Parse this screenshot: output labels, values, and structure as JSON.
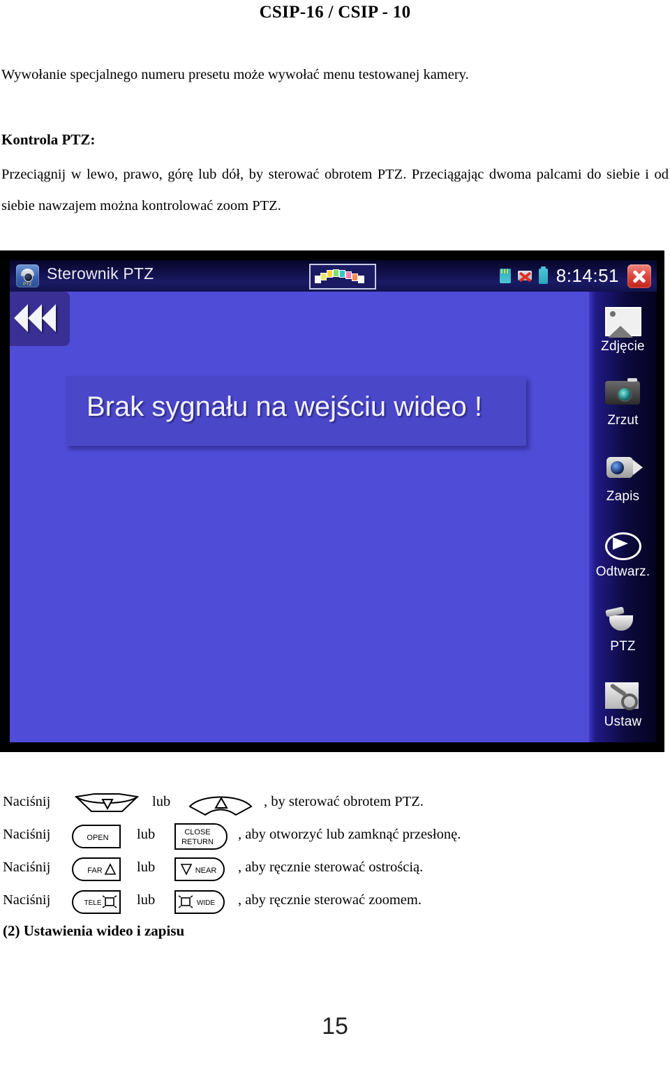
{
  "document": {
    "title": "CSIP-16 / CSIP - 10",
    "intro": "Wywołanie specjalnego numeru presetu może wywołać menu testowanej kamery.",
    "section_heading": "Kontrola PTZ:",
    "body": "Przeciągnij w lewo, prawo, górę lub dół, by sterować obrotem PTZ. Przeciągając dwoma palcami do siebie i od siebie nawzajem można kontrolować zoom PTZ.",
    "next_section": "(2) Ustawienia wideo i zapisu",
    "page_number": "15"
  },
  "screenshot": {
    "titlebar": {
      "app_icon": "ptz-camera-icon",
      "app_icon_tag": "PTZ",
      "title": "Sterownik PTZ",
      "signal_icon": "signal-waveform-icon",
      "sd_icon": "sd-card-icon",
      "network_icon": "network-disconnected-icon",
      "battery_icon": "battery-icon",
      "time": "8:14:51",
      "close_icon": "close-icon"
    },
    "back_button": "collapse-left-icon",
    "video_message": "Brak sygnału na wejściu wideo !",
    "colors": {
      "video_area": "#4f4cd8",
      "message_box": "#4b47c9",
      "titlebar": "#131350",
      "sidebar": "#0d0a3e",
      "close_button": "#e04b42",
      "frame": "#000000"
    },
    "sidebar": [
      {
        "icon": "picture-icon",
        "label": "Zdjęcie"
      },
      {
        "icon": "camera-icon",
        "label": "Zrzut"
      },
      {
        "icon": "camcorder-icon",
        "label": "Zapis"
      },
      {
        "icon": "play-icon",
        "label": "Odtwarz."
      },
      {
        "icon": "ptz-dome-icon",
        "label": "PTZ"
      },
      {
        "icon": "wrench-gear-icon",
        "label": "Ustaw"
      }
    ]
  },
  "instructions": [
    {
      "prefix": "Naciśnij",
      "button_a": {
        "shape": "arc-down-button",
        "glyph": "▽",
        "text": ""
      },
      "conj": "lub",
      "button_b": {
        "shape": "arc-up-button",
        "glyph": "△",
        "text": ""
      },
      "suffix": ", by sterować obrotem PTZ."
    },
    {
      "prefix": "Naciśnij",
      "button_a": {
        "shape": "round-left-button",
        "glyph": "",
        "text": "OPEN"
      },
      "conj": "lub",
      "button_b": {
        "shape": "round-right-button",
        "glyph": "",
        "text": "CLOSE RETURN"
      },
      "suffix": ", aby otworzyć lub zamknąć przesłonę."
    },
    {
      "prefix": "Naciśnij",
      "button_a": {
        "shape": "round-left-button",
        "glyph": "△",
        "text": "FAR"
      },
      "conj": "lub",
      "button_b": {
        "shape": "round-right-button",
        "glyph": "▽",
        "text": "NEAR"
      },
      "suffix": ", aby ręcznie sterować ostrością."
    },
    {
      "prefix": "Naciśnij",
      "button_a": {
        "shape": "round-left-button",
        "glyph": "zoom-in-icon",
        "text": "TELE"
      },
      "conj": "lub",
      "button_b": {
        "shape": "round-right-button",
        "glyph": "zoom-out-icon",
        "text": "WIDE"
      },
      "suffix": ", aby ręcznie sterować zoomem."
    }
  ],
  "button_labels": {
    "open": "OPEN",
    "close": "CLOSE",
    "return": "RETURN",
    "far": "FAR",
    "near": "NEAR",
    "tele": "TELE",
    "wide": "WIDE"
  }
}
